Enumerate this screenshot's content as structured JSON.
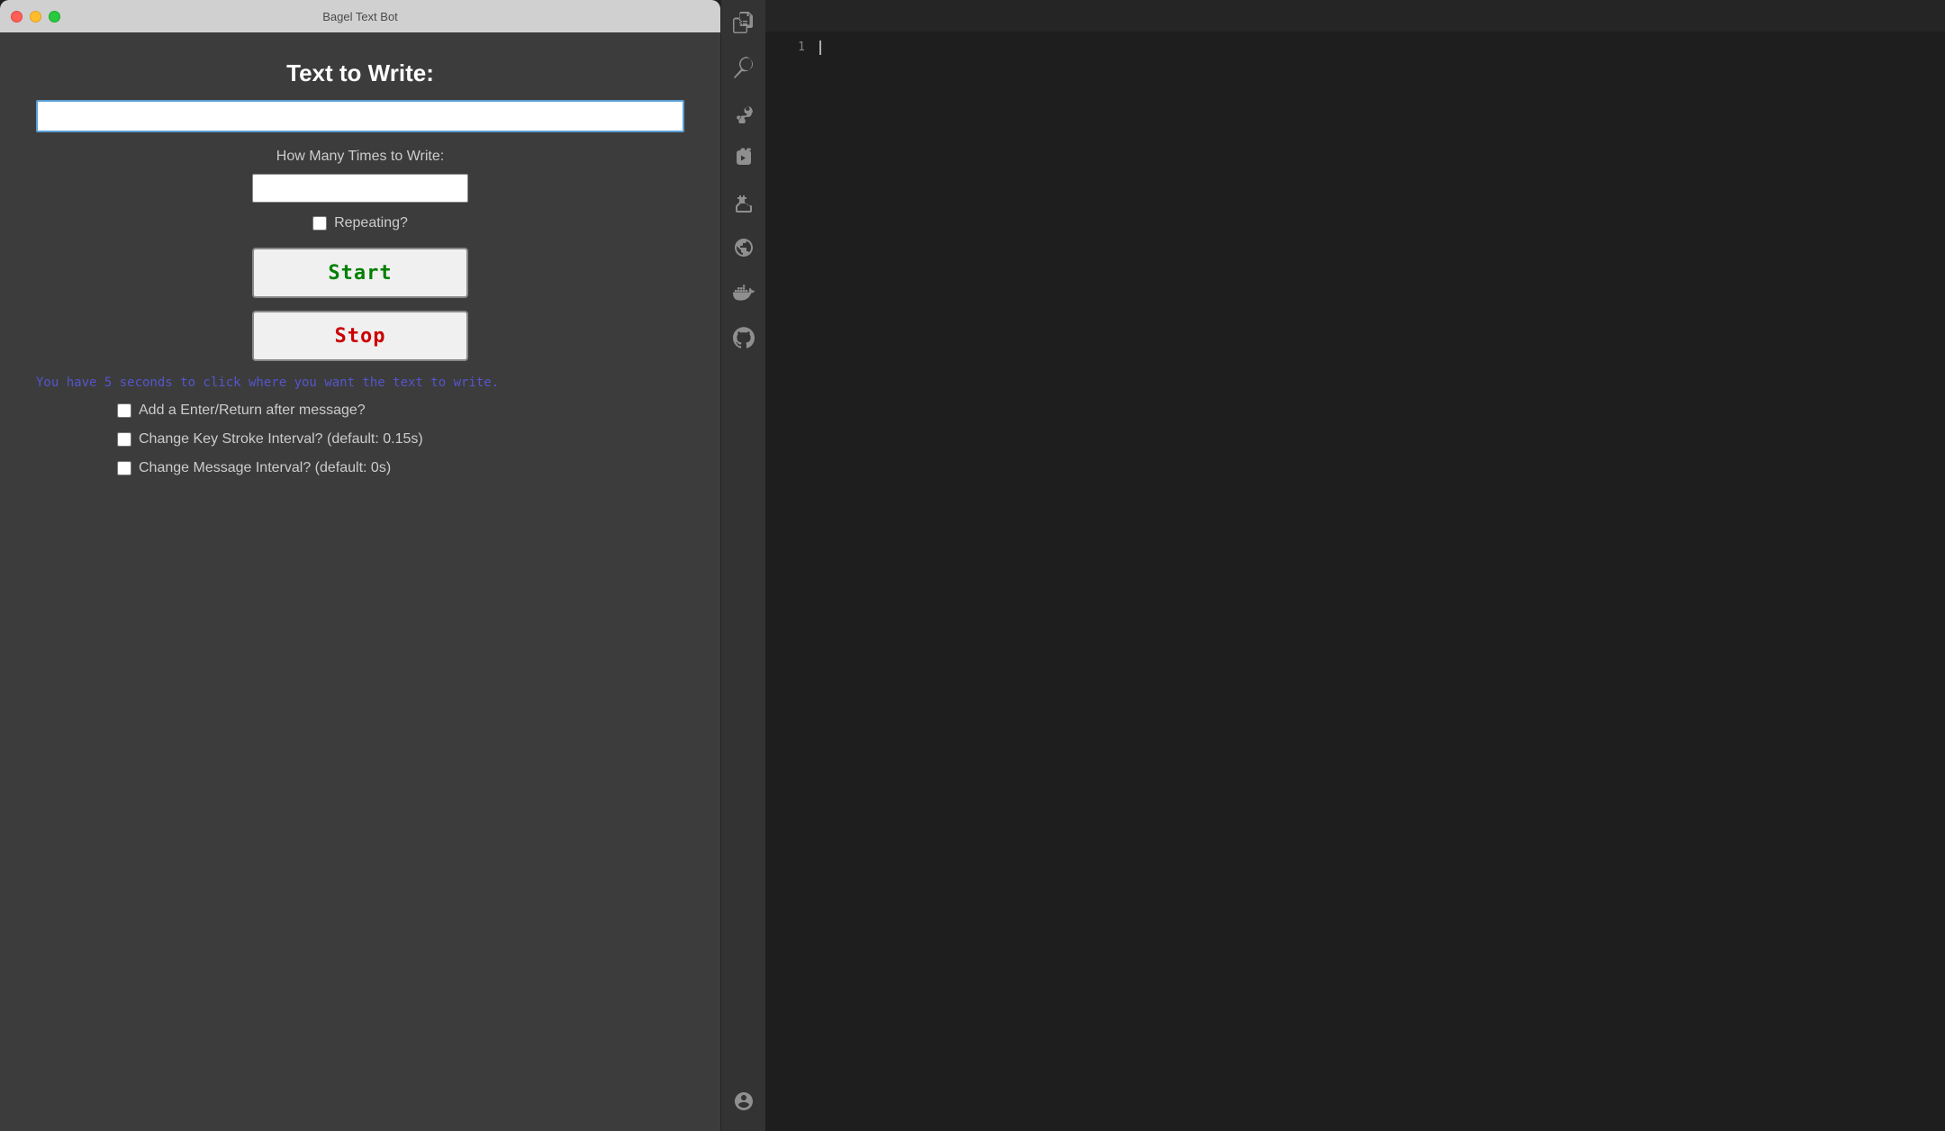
{
  "window": {
    "title": "Bagel Text Bot"
  },
  "traffic_lights": {
    "close": "close",
    "minimize": "minimize",
    "maximize": "maximize"
  },
  "app": {
    "main_title": "Text to Write:",
    "text_input_placeholder": "",
    "text_input_value": "",
    "how_many_label": "How Many Times to Write:",
    "count_input_value": "",
    "repeating_label": "Repeating?",
    "start_button_label": "Start",
    "stop_button_label": "Stop",
    "status_message": "You have 5 seconds to click where you want the text to write.",
    "option1_label": "Add a Enter/Return after message?",
    "option2_label": "Change Key Stroke Interval? (default: 0.15s)",
    "option3_label": "Change Message Interval? (default: 0s)"
  },
  "vscode": {
    "line_number": "1",
    "icons": [
      {
        "name": "files-icon",
        "title": "Explorer"
      },
      {
        "name": "search-icon",
        "title": "Search"
      },
      {
        "name": "source-control-icon",
        "title": "Source Control"
      },
      {
        "name": "run-debug-icon",
        "title": "Run and Debug"
      },
      {
        "name": "extensions-icon",
        "title": "Extensions"
      },
      {
        "name": "remote-icon",
        "title": "Remote Explorer"
      },
      {
        "name": "docker-icon",
        "title": "Docker"
      },
      {
        "name": "github-icon",
        "title": "GitHub"
      },
      {
        "name": "account-icon",
        "title": "Account"
      }
    ]
  }
}
